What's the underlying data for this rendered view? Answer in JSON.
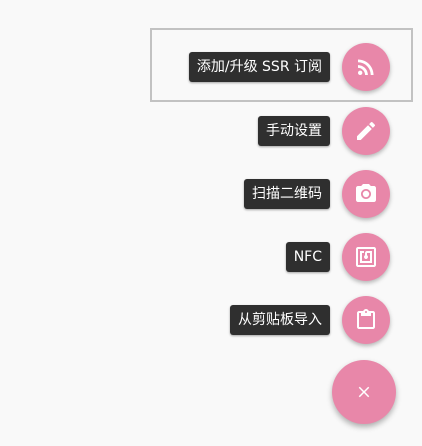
{
  "fab_menu": {
    "items": [
      {
        "label": "添加/升级 SSR 订阅",
        "icon": "rss-icon"
      },
      {
        "label": "手动设置",
        "icon": "pencil-icon"
      },
      {
        "label": "扫描二维码",
        "icon": "camera-icon"
      },
      {
        "label": "NFC",
        "icon": "nfc-icon"
      },
      {
        "label": "从剪贴板导入",
        "icon": "clipboard-icon"
      }
    ],
    "main_button_icon": "close-icon",
    "accent_color": "#e887a9"
  }
}
